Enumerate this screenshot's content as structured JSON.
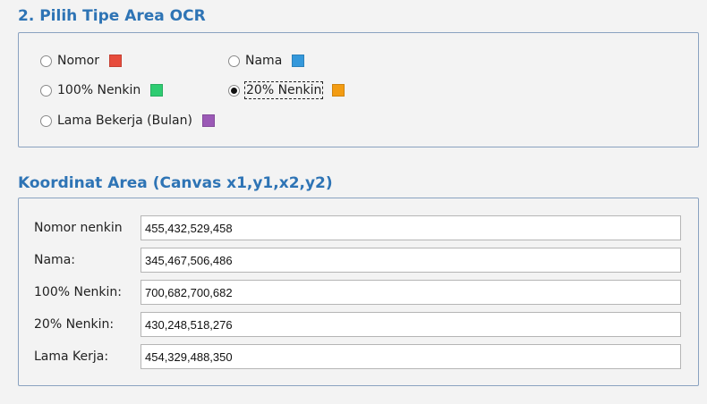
{
  "section1": {
    "title": "2. Pilih Tipe Area OCR",
    "options": [
      {
        "label": "Nomor",
        "color": "#e74c3c",
        "checked": false
      },
      {
        "label": "Nama",
        "color": "#3498db",
        "checked": false
      },
      {
        "label": "100% Nenkin",
        "color": "#2ecc71",
        "checked": false
      },
      {
        "label": "20% Nenkin",
        "color": "#f39c12",
        "checked": true
      },
      {
        "label": "Lama Bekerja (Bulan)",
        "color": "#9b59b6",
        "checked": false
      }
    ]
  },
  "section2": {
    "title": "Koordinat Area (Canvas x1,y1,x2,y2)",
    "fields": [
      {
        "label": "Nomor nenkin",
        "value": "455,432,529,458"
      },
      {
        "label": "Nama:",
        "value": "345,467,506,486"
      },
      {
        "label": "100% Nenkin:",
        "value": "700,682,700,682"
      },
      {
        "label": "20% Nenkin:",
        "value": "430,248,518,276"
      },
      {
        "label": "Lama Kerja:",
        "value": "454,329,488,350"
      }
    ]
  }
}
